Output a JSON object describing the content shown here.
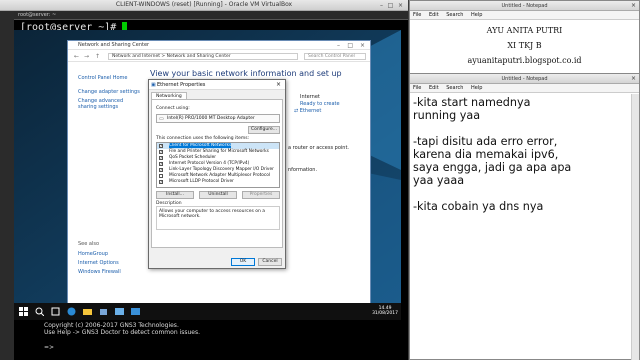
{
  "vbox": {
    "title": "CLIENT-WINDOWS (reset) [Running] - Oracle VM VirtualBox",
    "terminal_tab": "root@server: ~",
    "prompt": "[root@server ~]# ",
    "gns_lines": [
      "Copyright (c) 2006-2017 GNS3 Technologies.",
      "Use Help -> GNS3 Doctor to detect common issues."
    ],
    "gns_prompt": "=>"
  },
  "nsc": {
    "title": "Network and Sharing Center",
    "path": "Network and Internet  >  Network and Sharing Center",
    "search_placeholder": "Search Control Panel",
    "left_links": [
      "Control Panel Home",
      "Change adapter settings",
      "Change advanced sharing settings"
    ],
    "see_also_label": "See also",
    "see_also_links": [
      "HomeGroup",
      "Internet Options",
      "Windows Firewall"
    ],
    "heading": "View your basic network information and set up connections",
    "right_texts": [
      "Internet",
      "Ready to create",
      "Ethernet"
    ],
    "mid_texts": [
      "a router or access point.",
      "nformation."
    ]
  },
  "eth": {
    "title": "Ethernet Properties",
    "tab": "Networking",
    "connect_using_label": "Connect using:",
    "adapter": "Intel(R) PRO/1000 MT Desktop Adapter",
    "configure_btn": "Configure...",
    "items_label": "This connection uses the following items:",
    "items": [
      {
        "label": "Client for Microsoft Networks",
        "checked": true
      },
      {
        "label": "File and Printer Sharing for Microsoft Networks",
        "checked": true
      },
      {
        "label": "QoS Packet Scheduler",
        "checked": true
      },
      {
        "label": "Internet Protocol Version 4 (TCP/IPv4)",
        "checked": true
      },
      {
        "label": "Link-Layer Topology Discovery Mapper I/O Driver",
        "checked": true
      },
      {
        "label": "Microsoft Network Adapter Multiplexor Protocol",
        "checked": false
      },
      {
        "label": "Microsoft LLDP Protocol Driver",
        "checked": true
      }
    ],
    "install_btn": "Install...",
    "uninstall_btn": "Uninstall",
    "properties_btn": "Properties",
    "desc_label": "Description",
    "desc_text": "Allows your computer to access resources on a Microsoft network.",
    "ok_btn": "OK",
    "cancel_btn": "Cancel"
  },
  "taskbar": {
    "time": "14.49",
    "date": "31/08/2017"
  },
  "notepad1": {
    "title": "Untitled - Notepad",
    "menu": [
      "File",
      "Edit",
      "Search",
      "Help"
    ],
    "lines": [
      "AYU  ANITA  PUTRI",
      "XI  TKJ  B",
      "ayuanitaputri.blogspot.co.id"
    ]
  },
  "notepad2": {
    "title": "Untitled - Notepad",
    "menu": [
      "File",
      "Edit",
      "Search",
      "Help"
    ],
    "text": "-kita start namednya\nrunning yaa\n\n-tapi disitu ada erro error,\nkarena dia memakai ipv6,\nsaya engga, jadi ga apa apa\nyaa yaaa\n\n-kita cobain ya dns nya"
  }
}
